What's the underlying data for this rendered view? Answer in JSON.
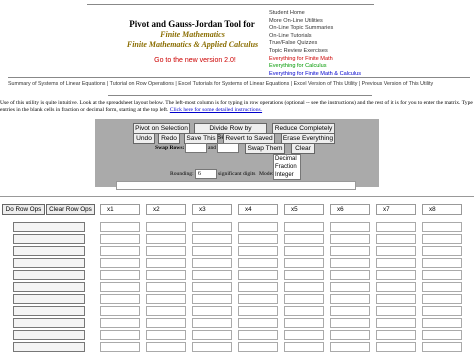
{
  "header": {
    "title_line1": "Pivot and Gauss-Jordan Tool for",
    "title_line2": "Finite Mathematics",
    "title_line3": "Finite Mathematics & Applied Calculus",
    "new_version": "Go to the new version 2.0!"
  },
  "nav_links": [
    {
      "label": "Student Home",
      "color": "#333333"
    },
    {
      "label": "More On-Line Utilities",
      "color": "#333333"
    },
    {
      "label": "On-Line Topic Summaries",
      "color": "#333333"
    },
    {
      "label": "On-Line Tutorials",
      "color": "#333333"
    },
    {
      "label": "True/False Quizzes",
      "color": "#333333"
    },
    {
      "label": "Topic Review Exercises",
      "color": "#333333"
    },
    {
      "label": "Everything for Finite Math",
      "color": "#cc0000"
    },
    {
      "label": "Everything for Calculus",
      "color": "#009900"
    },
    {
      "label": "Everything for Finite Math & Calculus",
      "color": "#0000cc"
    }
  ],
  "summary_bar": "Summary of Systems of Linear Equations | Tutorial on Row Operations | Excel Tutorials for Systems of Linear Equations | Excel Version of This Utility | Previous Version of This Utility",
  "intro": {
    "text": "Use of this utility is quite intuitive. Look at the spreadsheet layout below. The left-most column is for typing in row operations (optional -- see the instructions) and the rest of it is for you to enter the matrix. Type entries in the blank cells in fraction or decimal form, starting at the top left.",
    "link": "Click here for some detailed instructions."
  },
  "controls": {
    "pivot": "Pivot on Selection",
    "divide_row": "Divide Row by Selection",
    "reduce": "Reduce Completely",
    "undo": "Undo",
    "redo": "Redo",
    "save": "Save This",
    "revert": "Revert to Saved",
    "erase": "Erase Everything",
    "swap_rows_label": "Swap Rows:",
    "and_label": "and",
    "swap_button": "Swap Them",
    "clear": "Clear",
    "rounding_label": "Rounding:",
    "rounding_value": "6",
    "sig_digits_label": "significant digits",
    "mode_label": "Mode:",
    "mode_options": [
      "Decimal",
      "Fraction",
      "Integer"
    ]
  },
  "grid": {
    "do_row_ops": "Do Row Ops",
    "clear_row_ops": "Clear Row Ops",
    "columns": [
      "x1",
      "x2",
      "x3",
      "x4",
      "x5",
      "x6",
      "x7",
      "x8"
    ],
    "row_count": 11
  }
}
